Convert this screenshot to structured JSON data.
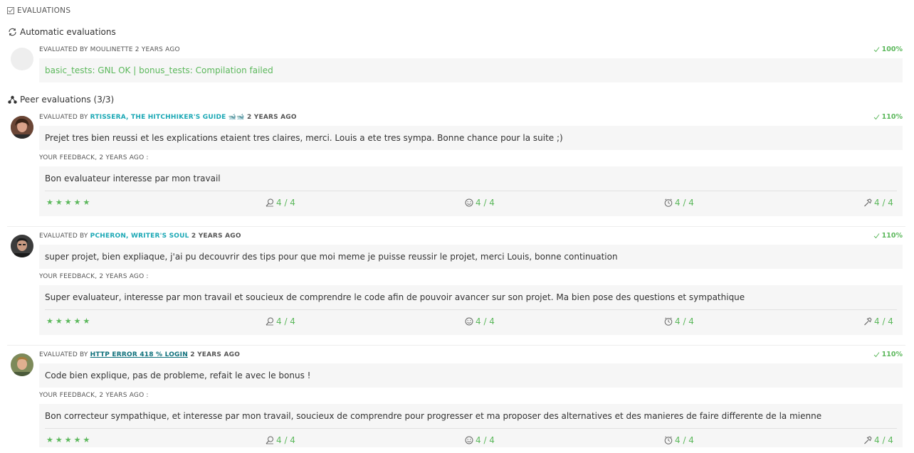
{
  "header": {
    "title": "EVALUATIONS"
  },
  "automatic": {
    "title": "Automatic evaluations",
    "evaluated_by_prefix": "EVALUATED BY ",
    "evaluator": "MOULINETTE",
    "when": " 2 YEARS AGO",
    "score": "100%",
    "result": "basic_tests: GNL OK | bonus_tests: Compilation failed"
  },
  "peer": {
    "title": "Peer evaluations (3/3)",
    "evaluations": [
      {
        "evaluated_by_prefix": "EVALUATED BY ",
        "evaluator": "RTISSERA, THE HITCHHIKER'S GUIDE 🐋🐋",
        "when": " 2 YEARS AGO",
        "score": "110%",
        "comment": "Prejet tres bien reussi et les explications etaient tres claires, merci. Louis a ete tres sympa. Bonne chance pour la suite ;)",
        "feedback_label": "YOUR FEEDBACK, 2 YEARS AGO :",
        "feedback": "Bon evaluateur interesse par mon travail",
        "stars": "★★★★★",
        "metrics": [
          "4 / 4",
          "4 / 4",
          "4 / 4",
          "4 / 4"
        ]
      },
      {
        "evaluated_by_prefix": "EVALUATED BY ",
        "evaluator": "PCHERON, WRITER'S SOUL",
        "when": " 2 YEARS AGO",
        "score": "110%",
        "comment": "super projet, bien expliaque, j'ai pu decouvrir des tips pour que moi meme je puisse reussir le projet, merci Louis, bonne continuation",
        "feedback_label": "YOUR FEEDBACK, 2 YEARS AGO :",
        "feedback": "Super evaluateur, interesse par mon travail et soucieux de comprendre le code afin de pouvoir avancer sur son projet. Ma bien pose des questions et sympathique",
        "stars": "★★★★★",
        "metrics": [
          "4 / 4",
          "4 / 4",
          "4 / 4",
          "4 / 4"
        ]
      },
      {
        "evaluated_by_prefix": "EVALUATED BY ",
        "evaluator": "HTTP ERROR 418 % LOGIN",
        "when": " 2 YEARS AGO",
        "score": "110%",
        "comment": "Code bien explique, pas de probleme, refait le avec le bonus !",
        "feedback_label": "YOUR FEEDBACK, 2 YEARS AGO :",
        "feedback": "Bon correcteur sympathique, et interesse par mon travail, soucieux de comprendre pour progresser et ma proposer des alternatives et des manieres de faire differente de la mienne",
        "stars": "★★★★★",
        "metrics": [
          "4 / 4",
          "4 / 4",
          "4 / 4",
          "4 / 4"
        ]
      }
    ]
  },
  "icons": {
    "header": "checkbox-icon",
    "automatic": "refresh-icon",
    "peer": "network-icon",
    "score": "check-icon",
    "metric_1": "magnifier-icon",
    "metric_2": "smiley-icon",
    "metric_3": "clock-icon",
    "metric_4": "hammer-icon"
  },
  "colors": {
    "accent": "#5cb85c",
    "link": "#1ba8b5",
    "box": "#f6f6f6"
  }
}
